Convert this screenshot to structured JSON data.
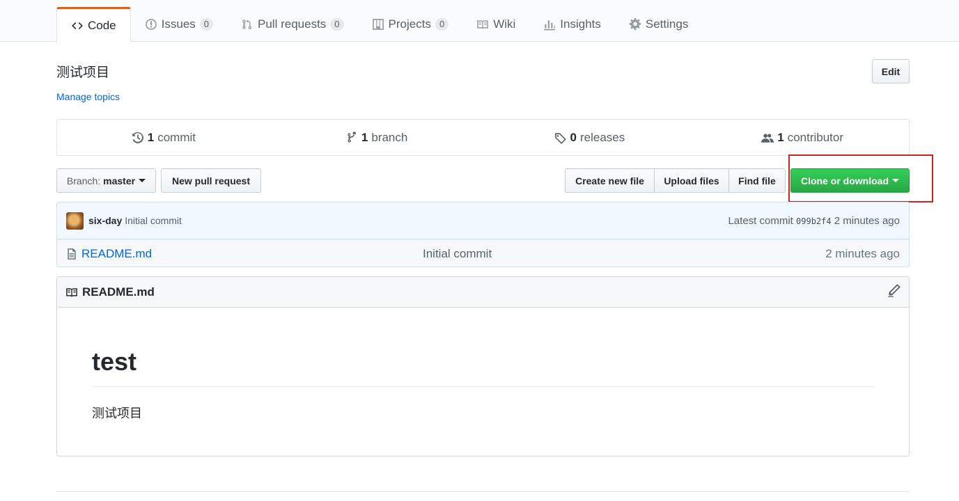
{
  "tabs": [
    {
      "label": "Code",
      "icon": "code-icon"
    },
    {
      "label": "Issues",
      "count": "0",
      "icon": "issue-icon"
    },
    {
      "label": "Pull requests",
      "count": "0",
      "icon": "pull-request-icon"
    },
    {
      "label": "Projects",
      "count": "0",
      "icon": "project-icon"
    },
    {
      "label": "Wiki",
      "icon": "book-icon"
    },
    {
      "label": "Insights",
      "icon": "graph-icon"
    },
    {
      "label": "Settings",
      "icon": "gear-icon"
    }
  ],
  "repo": {
    "description": "测试项目",
    "manage_topics": "Manage topics",
    "edit_label": "Edit"
  },
  "summary": {
    "commits": {
      "num": "1",
      "label": "commit"
    },
    "branches": {
      "num": "1",
      "label": "branch"
    },
    "releases": {
      "num": "0",
      "label": "releases"
    },
    "contributors": {
      "num": "1",
      "label": "contributor"
    }
  },
  "filenav": {
    "branch_label": "Branch:",
    "branch_value": "master",
    "new_pr": "New pull request",
    "create_file": "Create new file",
    "upload_files": "Upload files",
    "find_file": "Find file",
    "clone": "Clone or download"
  },
  "commit": {
    "author": "six-day",
    "message": "Initial commit",
    "latest_label": "Latest commit",
    "sha": "099b2f4",
    "age": "2 minutes ago"
  },
  "files": [
    {
      "name": "README.md",
      "message": "Initial commit",
      "age": "2 minutes ago"
    }
  ],
  "readme": {
    "filename": "README.md",
    "heading": "test",
    "paragraph": "测试项目"
  },
  "colors": {
    "accent_tab": "#e36209",
    "link": "#0366d6",
    "clone_green": "#28a745",
    "highlight_red": "#d61f1f"
  }
}
